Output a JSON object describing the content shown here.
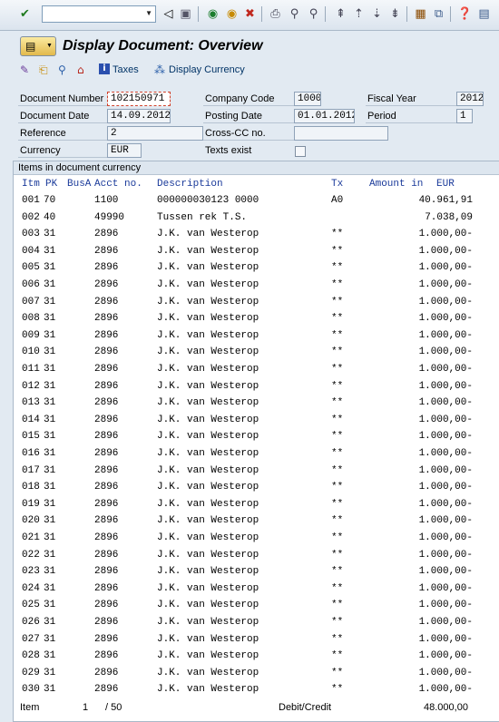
{
  "toolbar": {
    "command_field": "",
    "icons": [
      "enter-icon",
      "back-icon",
      "save-icon",
      "back-green-icon",
      "exit-icon",
      "cancel-icon",
      "print-icon",
      "find-icon",
      "find-next-icon",
      "first-page-icon",
      "previous-page-icon",
      "next-page-icon",
      "last-page-icon",
      "create-session-icon",
      "shortcut-icon",
      "help-icon",
      "customize-icon"
    ]
  },
  "title": "Display Document: Overview",
  "app_toolbar": {
    "taxes_label": "Taxes",
    "display_currency_label": "Display Currency"
  },
  "header": {
    "document_number_label": "Document Number",
    "document_number": "102150971",
    "company_code_label": "Company Code",
    "company_code": "1000",
    "fiscal_year_label": "Fiscal Year",
    "fiscal_year": "2012",
    "document_date_label": "Document Date",
    "document_date": "14.09.2012",
    "posting_date_label": "Posting Date",
    "posting_date": "01.01.2012",
    "period_label": "Period",
    "period": "1",
    "reference_label": "Reference",
    "reference": "2",
    "cross_cc_label": "Cross-CC no.",
    "cross_cc": "",
    "currency_label": "Currency",
    "currency": "EUR",
    "texts_exist_label": "Texts exist"
  },
  "table": {
    "caption": "Items in document currency",
    "columns": {
      "itm": "Itm",
      "pk": "PK",
      "busa": "BusA",
      "acct": "Acct no.",
      "desc": "Description",
      "tx": "Tx",
      "amount": "Amount in",
      "currency": "EUR"
    },
    "rows": [
      [
        "001",
        "70",
        "",
        "1100",
        "000000030123 0000",
        "A0",
        "40.961,91"
      ],
      [
        "002",
        "40",
        "",
        "49990",
        "Tussen rek T.S.",
        "",
        "7.038,09"
      ],
      [
        "003",
        "31",
        "",
        "2896",
        "J.K. van Westerop",
        "**",
        "1.000,00-"
      ],
      [
        "004",
        "31",
        "",
        "2896",
        "J.K. van Westerop",
        "**",
        "1.000,00-"
      ],
      [
        "005",
        "31",
        "",
        "2896",
        "J.K. van Westerop",
        "**",
        "1.000,00-"
      ],
      [
        "006",
        "31",
        "",
        "2896",
        "J.K. van Westerop",
        "**",
        "1.000,00-"
      ],
      [
        "007",
        "31",
        "",
        "2896",
        "J.K. van Westerop",
        "**",
        "1.000,00-"
      ],
      [
        "008",
        "31",
        "",
        "2896",
        "J.K. van Westerop",
        "**",
        "1.000,00-"
      ],
      [
        "009",
        "31",
        "",
        "2896",
        "J.K. van Westerop",
        "**",
        "1.000,00-"
      ],
      [
        "010",
        "31",
        "",
        "2896",
        "J.K. van Westerop",
        "**",
        "1.000,00-"
      ],
      [
        "011",
        "31",
        "",
        "2896",
        "J.K. van Westerop",
        "**",
        "1.000,00-"
      ],
      [
        "012",
        "31",
        "",
        "2896",
        "J.K. van Westerop",
        "**",
        "1.000,00-"
      ],
      [
        "013",
        "31",
        "",
        "2896",
        "J.K. van Westerop",
        "**",
        "1.000,00-"
      ],
      [
        "014",
        "31",
        "",
        "2896",
        "J.K. van Westerop",
        "**",
        "1.000,00-"
      ],
      [
        "015",
        "31",
        "",
        "2896",
        "J.K. van Westerop",
        "**",
        "1.000,00-"
      ],
      [
        "016",
        "31",
        "",
        "2896",
        "J.K. van Westerop",
        "**",
        "1.000,00-"
      ],
      [
        "017",
        "31",
        "",
        "2896",
        "J.K. van Westerop",
        "**",
        "1.000,00-"
      ],
      [
        "018",
        "31",
        "",
        "2896",
        "J.K. van Westerop",
        "**",
        "1.000,00-"
      ],
      [
        "019",
        "31",
        "",
        "2896",
        "J.K. van Westerop",
        "**",
        "1.000,00-"
      ],
      [
        "020",
        "31",
        "",
        "2896",
        "J.K. van Westerop",
        "**",
        "1.000,00-"
      ],
      [
        "021",
        "31",
        "",
        "2896",
        "J.K. van Westerop",
        "**",
        "1.000,00-"
      ],
      [
        "022",
        "31",
        "",
        "2896",
        "J.K. van Westerop",
        "**",
        "1.000,00-"
      ],
      [
        "023",
        "31",
        "",
        "2896",
        "J.K. van Westerop",
        "**",
        "1.000,00-"
      ],
      [
        "024",
        "31",
        "",
        "2896",
        "J.K. van Westerop",
        "**",
        "1.000,00-"
      ],
      [
        "025",
        "31",
        "",
        "2896",
        "J.K. van Westerop",
        "**",
        "1.000,00-"
      ],
      [
        "026",
        "31",
        "",
        "2896",
        "J.K. van Westerop",
        "**",
        "1.000,00-"
      ],
      [
        "027",
        "31",
        "",
        "2896",
        "J.K. van Westerop",
        "**",
        "1.000,00-"
      ],
      [
        "028",
        "31",
        "",
        "2896",
        "J.K. van Westerop",
        "**",
        "1.000,00-"
      ],
      [
        "029",
        "31",
        "",
        "2896",
        "J.K. van Westerop",
        "**",
        "1.000,00-"
      ],
      [
        "030",
        "31",
        "",
        "2896",
        "J.K. van Westerop",
        "**",
        "1.000,00-"
      ]
    ]
  },
  "footer": {
    "item_label": "Item",
    "item_current": "1",
    "item_total": "/ 50",
    "debit_credit_label": "Debit/Credit",
    "debit_credit_value": "48.000,00"
  }
}
